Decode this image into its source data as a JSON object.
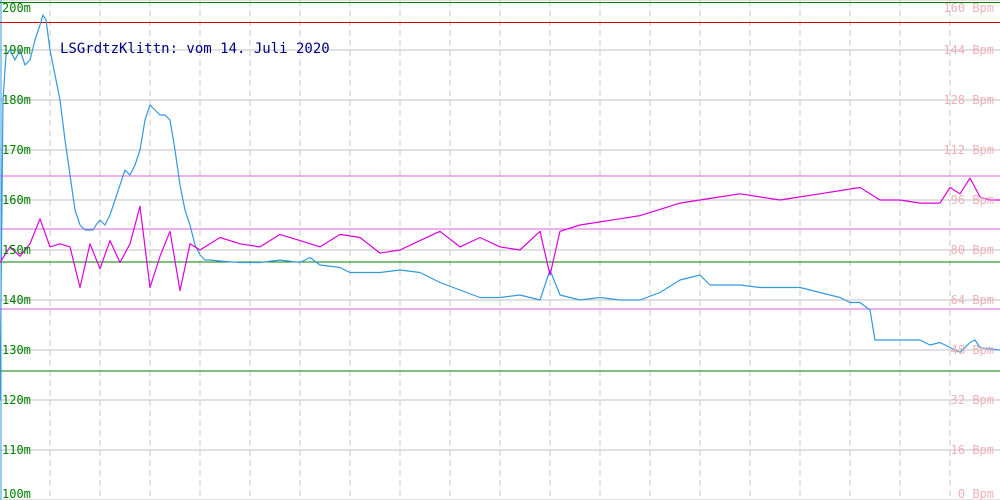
{
  "chart_data": {
    "type": "line",
    "title": "LSGrdtzKlittn: vom 14. Juli 2020",
    "y_left": {
      "ylim": [
        100,
        200
      ],
      "tick_values": [
        100,
        110,
        120,
        130,
        140,
        150,
        160,
        170,
        180,
        190,
        200
      ],
      "tick_labels": [
        "100m",
        "110m",
        "120m",
        "130m",
        "140m",
        "150m",
        "160m",
        "170m",
        "180m",
        "190m",
        "200m"
      ],
      "color": "#008000"
    },
    "y_right": {
      "ylim": [
        0,
        160
      ],
      "tick_values": [
        0,
        16,
        32,
        48,
        64,
        80,
        96,
        112,
        128,
        144,
        160
      ],
      "tick_labels": [
        "0 Bpm",
        "16 Bpm",
        "32 Bpm",
        "48 Bpm",
        "64 Bpm",
        "80 Bpm",
        "96 Bpm",
        "112 Bpm",
        "128 Bpm",
        "144 Bpm",
        "160 Bpm"
      ],
      "color": "#f0b0b8"
    },
    "x_range": [
      0,
      100
    ],
    "grid": true,
    "reference_lines": [
      {
        "axis": "left",
        "value": 199.5,
        "color": "#008000"
      },
      {
        "axis": "left",
        "value": 195.5,
        "color": "#cc0000"
      },
      {
        "axis": "left",
        "value": 164.8,
        "color": "#e060e0"
      },
      {
        "axis": "left",
        "value": 154.2,
        "color": "#e060e0"
      },
      {
        "axis": "left",
        "value": 147.6,
        "color": "#008000"
      },
      {
        "axis": "left",
        "value": 138.2,
        "color": "#e060e0"
      },
      {
        "axis": "left",
        "value": 125.8,
        "color": "#008000"
      }
    ],
    "series": [
      {
        "axis": "left",
        "color": "#3399dd",
        "x": [
          0,
          0.3,
          0.6,
          1,
          1.5,
          2,
          2.5,
          3,
          3.5,
          4,
          4.3,
          4.6,
          5,
          5.5,
          6,
          6.5,
          7,
          7.5,
          8,
          8.5,
          9,
          9.3,
          9.6,
          10,
          10.5,
          11,
          11.5,
          12,
          12.5,
          13,
          13.5,
          14,
          14.5,
          15,
          15.5,
          16,
          16.5,
          17,
          17.5,
          18,
          18.5,
          19,
          19.5,
          20,
          20.5,
          21,
          22,
          24,
          26,
          28,
          30,
          31,
          32,
          34,
          35,
          36,
          38,
          40,
          42,
          44,
          46,
          48,
          50,
          52,
          54,
          55,
          56,
          58,
          60,
          62,
          64,
          66,
          68,
          70,
          71,
          72,
          74,
          76,
          78,
          80,
          82,
          84,
          85,
          86,
          87,
          87.5,
          88,
          90,
          92,
          93,
          94,
          95,
          96,
          97,
          97.5,
          98,
          99,
          100
        ],
        "y": [
          120,
          180,
          189,
          190,
          188,
          190,
          187,
          188,
          192,
          195,
          197,
          196,
          190,
          185,
          180,
          172,
          165,
          158,
          155,
          154,
          154,
          154,
          155,
          156,
          155,
          157,
          160,
          163,
          166,
          165,
          167,
          170,
          176,
          179,
          178,
          177,
          177,
          176,
          170,
          163,
          158,
          155,
          151,
          149,
          148,
          148,
          147.8,
          147.5,
          147.5,
          148,
          147.5,
          148.5,
          147,
          146.5,
          145.5,
          145.5,
          145.5,
          146,
          145.5,
          143.5,
          142,
          140.5,
          140.5,
          141,
          140,
          146,
          141,
          140,
          140.5,
          140,
          140,
          141.5,
          144,
          145,
          143,
          143,
          143,
          142.5,
          142.5,
          142.5,
          141.5,
          140.5,
          139.5,
          139.5,
          138,
          132,
          132,
          132,
          132,
          131,
          131.5,
          130.5,
          129.5,
          131.5,
          132,
          130.5,
          130.2,
          130
        ]
      },
      {
        "axis": "right",
        "color": "#dd00dd",
        "x": [
          0,
          1,
          2,
          3,
          4,
          5,
          6,
          7,
          8,
          9,
          10,
          11,
          12,
          13,
          14,
          15,
          16,
          17,
          18,
          19,
          20,
          22,
          24,
          26,
          28,
          30,
          32,
          34,
          36,
          38,
          40,
          42,
          44,
          46,
          48,
          50,
          52,
          54,
          55,
          56,
          58,
          60,
          62,
          64,
          66,
          68,
          70,
          72,
          74,
          76,
          78,
          80,
          82,
          84,
          86,
          88,
          90,
          92,
          94,
          95,
          96,
          97,
          98,
          99,
          100
        ],
        "y": [
          76,
          81,
          78,
          82,
          90,
          81,
          82,
          81,
          68,
          82,
          74,
          83,
          76,
          82,
          94,
          68,
          78,
          86,
          67,
          82,
          80,
          84,
          82,
          81,
          85,
          83,
          81,
          85,
          84,
          79,
          80,
          83,
          86,
          81,
          84,
          81,
          80,
          86,
          72,
          86,
          88,
          89,
          90,
          91,
          93,
          95,
          96,
          97,
          98,
          97,
          96,
          97,
          98,
          99,
          100,
          96,
          96,
          95,
          95,
          100,
          98,
          103,
          97,
          96,
          96
        ]
      }
    ]
  }
}
